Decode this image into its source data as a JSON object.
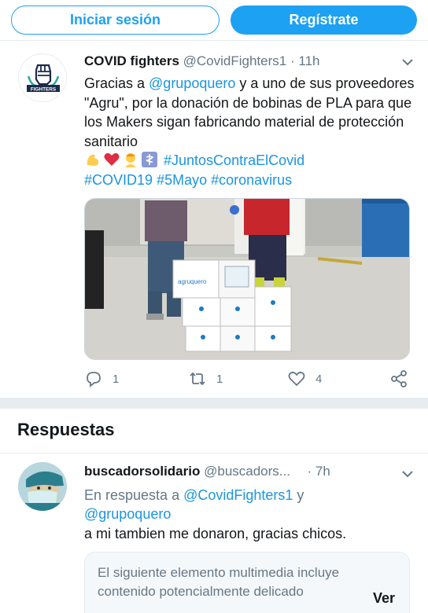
{
  "topbar": {
    "login_label": "Iniciar sesión",
    "signup_label": "Regístrate"
  },
  "tweet": {
    "name": "COVID fighters",
    "handle": "@CovidFighters1",
    "dot": "·",
    "time": "11h",
    "text_1": "Gracias a ",
    "mention": "@grupoquero",
    "text_2": " y a uno de sus proveedores \"Agru\", por la donación de bobinas de PLA para que los Makers sigan fabricando material de protección sanitario",
    "emojis": [
      "flexed-biceps-emoji",
      "red-heart-emoji",
      "health-worker-emoji",
      "medical-symbol-emoji"
    ],
    "hashtag_1": "#JuntosContraElCovid",
    "hashtag_2": "#COVID19",
    "hashtag_3": "#5Mayo",
    "hashtag_4": "#coronavirus",
    "media_box_label": "agruquero",
    "avatar_label": "FIGHTERS",
    "reply_count": "1",
    "retweet_count": "1",
    "like_count": "4"
  },
  "section": {
    "title": "Respuestas"
  },
  "reply": {
    "name": "buscadorsolidario",
    "handle": "@buscadors...",
    "dot": "·",
    "time": "7h",
    "in_reply_prefix": "En respuesta a ",
    "in_reply_user_1": "@CovidFighters1",
    "in_reply_and": " y ",
    "in_reply_user_2": "@grupoquero",
    "text": "a mi tambien me donaron, gracias chicos.",
    "sensitive_message": "El siguiente elemento multimedia incluye contenido potencialmente delicado",
    "view_label": "Ver"
  },
  "colors": {
    "accent": "#1da1f2",
    "link": "#1b95e0",
    "muted": "#657786",
    "text": "#14171a"
  }
}
